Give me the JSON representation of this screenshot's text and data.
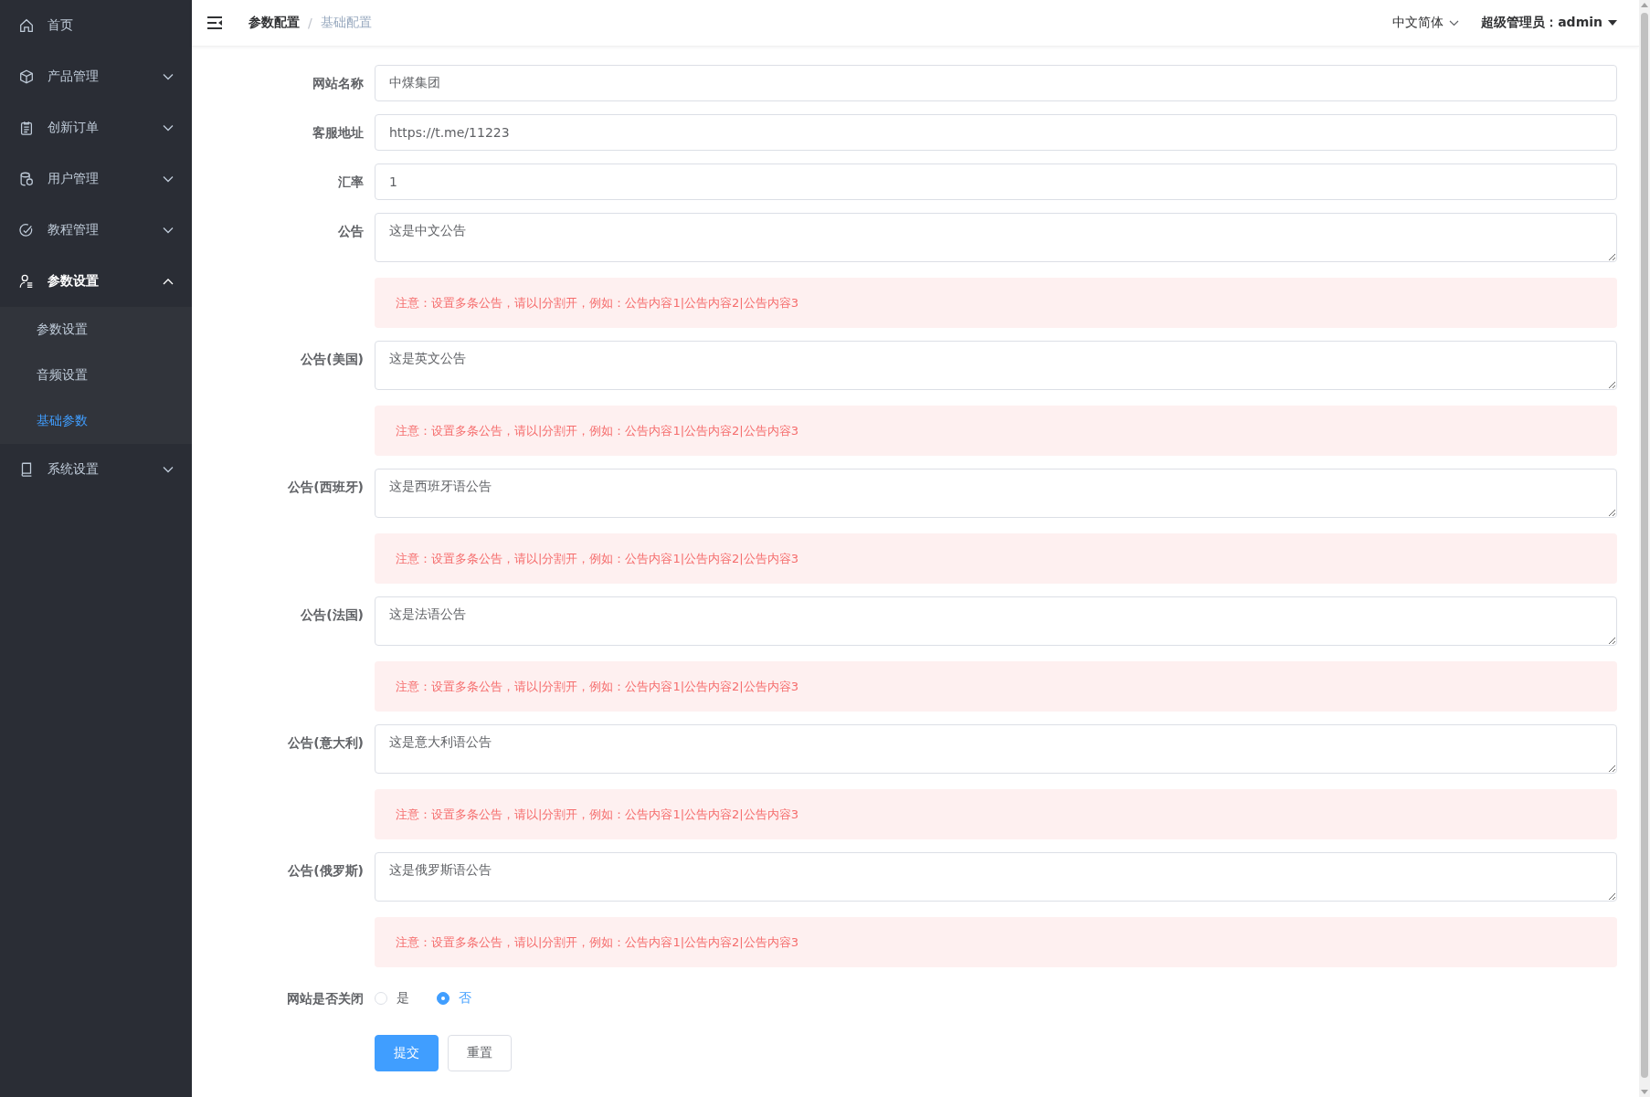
{
  "sidebar": {
    "items": [
      {
        "kind": "link",
        "label": "首页"
      },
      {
        "kind": "group",
        "label": "产品管理",
        "expanded": false
      },
      {
        "kind": "group",
        "label": "创新订单",
        "expanded": false
      },
      {
        "kind": "group",
        "label": "用户管理",
        "expanded": false
      },
      {
        "kind": "group",
        "label": "教程管理",
        "expanded": false
      },
      {
        "kind": "group",
        "label": "参数设置",
        "expanded": true,
        "children": [
          {
            "label": "参数设置",
            "selected": false
          },
          {
            "label": "音频设置",
            "selected": false
          },
          {
            "label": "基础参数",
            "selected": true
          }
        ]
      },
      {
        "kind": "group",
        "label": "系统设置",
        "expanded": false
      }
    ]
  },
  "header": {
    "breadcrumb": [
      "参数配置",
      "基础配置"
    ],
    "separator": "/",
    "language": "中文简体",
    "user": "超级管理员：admin"
  },
  "form": {
    "fields": [
      {
        "kind": "input",
        "label": "网站名称",
        "value": "中煤集团"
      },
      {
        "kind": "input",
        "label": "客服地址",
        "value": "https://t.me/11223"
      },
      {
        "kind": "input",
        "label": "汇率",
        "value": "1"
      },
      {
        "kind": "textarea",
        "label": "公告",
        "value": "这是中文公告",
        "note": "注意：设置多条公告，请以|分割开，例如：公告内容1|公告内容2|公告内容3"
      },
      {
        "kind": "textarea",
        "label": "公告(美国)",
        "value": "这是英文公告",
        "note": "注意：设置多条公告，请以|分割开，例如：公告内容1|公告内容2|公告内容3"
      },
      {
        "kind": "textarea",
        "label": "公告(西班牙)",
        "value": "这是西班牙语公告",
        "note": "注意：设置多条公告，请以|分割开，例如：公告内容1|公告内容2|公告内容3"
      },
      {
        "kind": "textarea",
        "label": "公告(法国)",
        "value": "这是法语公告",
        "note": "注意：设置多条公告，请以|分割开，例如：公告内容1|公告内容2|公告内容3"
      },
      {
        "kind": "textarea",
        "label": "公告(意大利)",
        "value": "这是意大利语公告",
        "note": "注意：设置多条公告，请以|分割开，例如：公告内容1|公告内容2|公告内容3"
      },
      {
        "kind": "textarea",
        "label": "公告(俄罗斯)",
        "value": "这是俄罗斯语公告",
        "note": "注意：设置多条公告，请以|分割开，例如：公告内容1|公告内容2|公告内容3"
      },
      {
        "kind": "radio",
        "label": "网站是否关闭",
        "options": [
          {
            "label": "是",
            "selected": false
          },
          {
            "label": "否",
            "selected": true
          }
        ]
      }
    ],
    "buttons": [
      {
        "kind": "primary",
        "label": "提交"
      },
      {
        "kind": "default",
        "label": "重置"
      }
    ]
  }
}
